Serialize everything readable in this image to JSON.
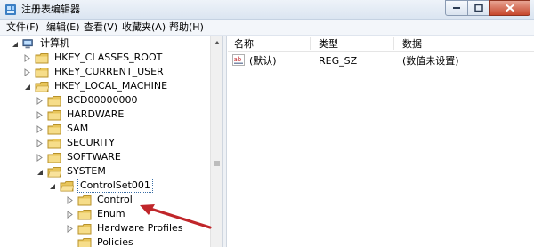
{
  "window": {
    "title": "注册表编辑器",
    "controls": {
      "minimize": "minimize-icon",
      "maximize": "maximize-icon",
      "close": "close-icon"
    }
  },
  "menu": [
    "文件(F)",
    "编辑(E)",
    "查看(V)",
    "收藏夹(A)",
    "帮助(H)"
  ],
  "tree": {
    "root": "计算机",
    "hives": [
      "HKEY_CLASSES_ROOT",
      "HKEY_CURRENT_USER",
      "HKEY_LOCAL_MACHINE"
    ],
    "hklm_children": [
      "BCD00000000",
      "HARDWARE",
      "SAM",
      "SECURITY",
      "SOFTWARE",
      "SYSTEM"
    ],
    "system_child_selected": "ControlSet001",
    "controlset_children": [
      "Control",
      "Enum",
      "Hardware Profiles",
      "Policies"
    ]
  },
  "columns": {
    "name": "名称",
    "type": "类型",
    "data": "数据"
  },
  "values": [
    {
      "name": "(默认)",
      "type": "REG_SZ",
      "data": "(数值未设置)",
      "icon": "string-value-icon"
    }
  ],
  "colors": {
    "arrow": "#c0262a",
    "folder": "#e8c55a",
    "selection_outline": "#3a6ea5"
  }
}
